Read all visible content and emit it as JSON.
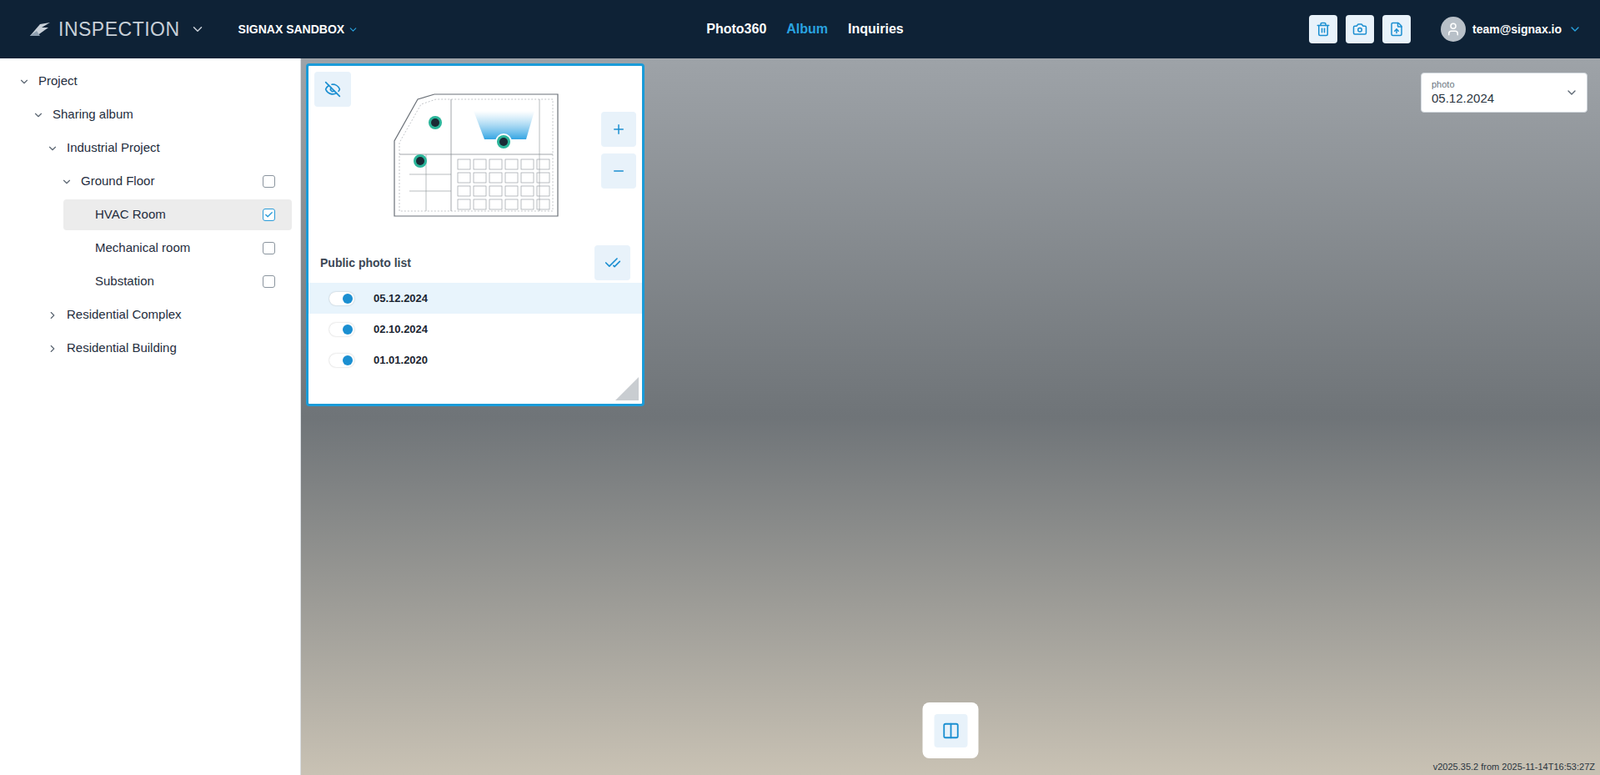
{
  "header": {
    "app_title": "INSPECTION",
    "workspace": "SIGNAX SANDBOX",
    "user_email": "team@signax.io"
  },
  "nav_tabs": [
    {
      "label": "Photo360",
      "selected": false
    },
    {
      "label": "Album",
      "selected": true
    },
    {
      "label": "Inquiries",
      "selected": false
    }
  ],
  "tree": [
    {
      "label": "Project",
      "level": 0,
      "kind": "branch",
      "expanded": true,
      "selected": false
    },
    {
      "label": "Sharing album",
      "level": 1,
      "kind": "branch",
      "expanded": true,
      "selected": false
    },
    {
      "label": "Industrial Project",
      "level": 2,
      "kind": "branch",
      "expanded": true,
      "selected": false
    },
    {
      "label": "Ground Floor",
      "level": 3,
      "kind": "floor",
      "expanded": true,
      "checked": false,
      "selected": false
    },
    {
      "label": "HVAC Room",
      "level": 4,
      "kind": "room",
      "checked": true,
      "selected": true
    },
    {
      "label": "Mechanical room",
      "level": 4,
      "kind": "room",
      "checked": false,
      "selected": false
    },
    {
      "label": "Substation",
      "level": 4,
      "kind": "room",
      "checked": false,
      "selected": false
    },
    {
      "label": "Residential Complex",
      "level": 2,
      "kind": "branch",
      "expanded": false,
      "selected": false
    },
    {
      "label": "Residential Building",
      "level": 2,
      "kind": "branch",
      "expanded": false,
      "selected": false
    }
  ],
  "minimap": {
    "list_title": "Public photo list",
    "photos": [
      {
        "date": "05.12.2024",
        "on": true,
        "selected": true
      },
      {
        "date": "02.10.2024",
        "on": true,
        "selected": false
      },
      {
        "date": "01.01.2020",
        "on": true,
        "selected": false
      }
    ]
  },
  "photo_select": {
    "label": "photo",
    "value": "05.12.2024"
  },
  "version": "v2025.35.2 from 2025-11-14T16:53:27Z"
}
